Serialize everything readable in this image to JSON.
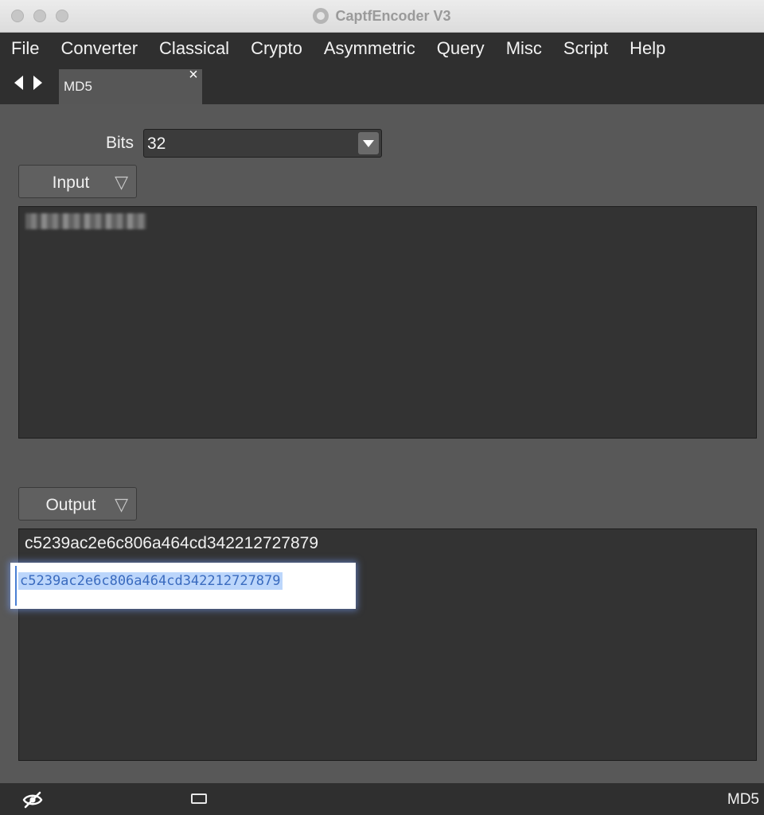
{
  "window": {
    "title": "CaptfEncoder V3"
  },
  "menu": {
    "items": [
      "File",
      "Converter",
      "Classical",
      "Crypto",
      "Asymmetric",
      "Query",
      "Misc",
      "Script",
      "Help"
    ]
  },
  "tabs": [
    {
      "label": "MD5",
      "close": "×"
    }
  ],
  "bits": {
    "label": "Bits",
    "value": "32"
  },
  "input": {
    "button_label": "Input",
    "text": ""
  },
  "output": {
    "button_label": "Output",
    "text": "c5239ac2e6c806a464cd342212727879",
    "selected_text": "c5239ac2e6c806a464cd342212727879"
  },
  "statusbar": {
    "label": "MD5"
  },
  "icons": {
    "nav_back": "arrow-left-icon",
    "nav_forward": "arrow-right-icon",
    "dropdown": "triangle-down-icon",
    "visibility": "eye-slash-icon",
    "panel": "rectangle-icon"
  },
  "colors": {
    "background": "#585858",
    "menubar": "#2f2f2f",
    "textarea": "#333333",
    "selection": "#bcd6fb"
  }
}
